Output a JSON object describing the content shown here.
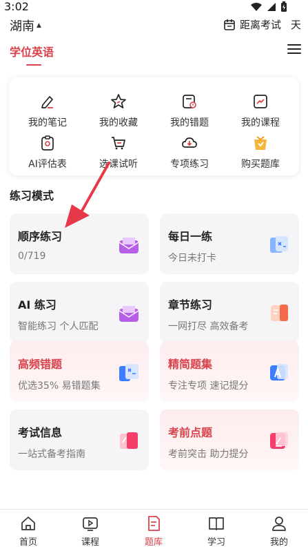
{
  "status": {
    "time": "3:02"
  },
  "header": {
    "province": "湖南",
    "countdown_label": "距离考试",
    "countdown_unit": "天"
  },
  "subject": {
    "title": "学位英语"
  },
  "quick": [
    {
      "label": "我的笔记",
      "icon": "pen-note-icon"
    },
    {
      "label": "我的收藏",
      "icon": "star-icon"
    },
    {
      "label": "我的错题",
      "icon": "wrong-questions-icon"
    },
    {
      "label": "我的课程",
      "icon": "course-chart-icon"
    },
    {
      "label": "AI评估表",
      "icon": "ai-assessment-icon"
    },
    {
      "label": "选课试听",
      "icon": "cart-icon"
    },
    {
      "label": "专项练习",
      "icon": "cloud-download-icon"
    },
    {
      "label": "购买题库",
      "icon": "shopping-bag-icon"
    }
  ],
  "section": {
    "title": "练习模式"
  },
  "modes": [
    {
      "title": "顺序练习",
      "sub": "0/719",
      "icon": "purple-envelope-icon"
    },
    {
      "title": "每日一练",
      "sub": "今日未打卡",
      "icon": "blue-calendar-icon"
    },
    {
      "title": "AI 练习",
      "sub": "智能练习 个人匹配",
      "icon": "purple-envelope-icon"
    },
    {
      "title": "章节练习",
      "sub": "一网打尽 高效备考",
      "icon": "orange-book-icon"
    },
    {
      "title": "高频错题",
      "sub": "优选35% 易错题集",
      "icon": "blue-quiz-icon"
    },
    {
      "title": "精简题集",
      "sub": "专注专项 速记提分",
      "icon": "blue-a-icon"
    },
    {
      "title": "考试信息",
      "sub": "一站式备考指南",
      "icon": "pink-card-icon"
    },
    {
      "title": "考前点题",
      "sub": "考前突击 助力提分",
      "icon": "pink-edit-icon"
    }
  ],
  "tabs": [
    {
      "label": "首页",
      "icon": "home-icon"
    },
    {
      "label": "课程",
      "icon": "video-icon"
    },
    {
      "label": "题库",
      "icon": "question-bank-icon"
    },
    {
      "label": "学习",
      "icon": "book-icon"
    },
    {
      "label": "我的",
      "icon": "user-icon"
    }
  ],
  "colors": {
    "accent": "#d9414b",
    "card": "#f5f5f7"
  }
}
